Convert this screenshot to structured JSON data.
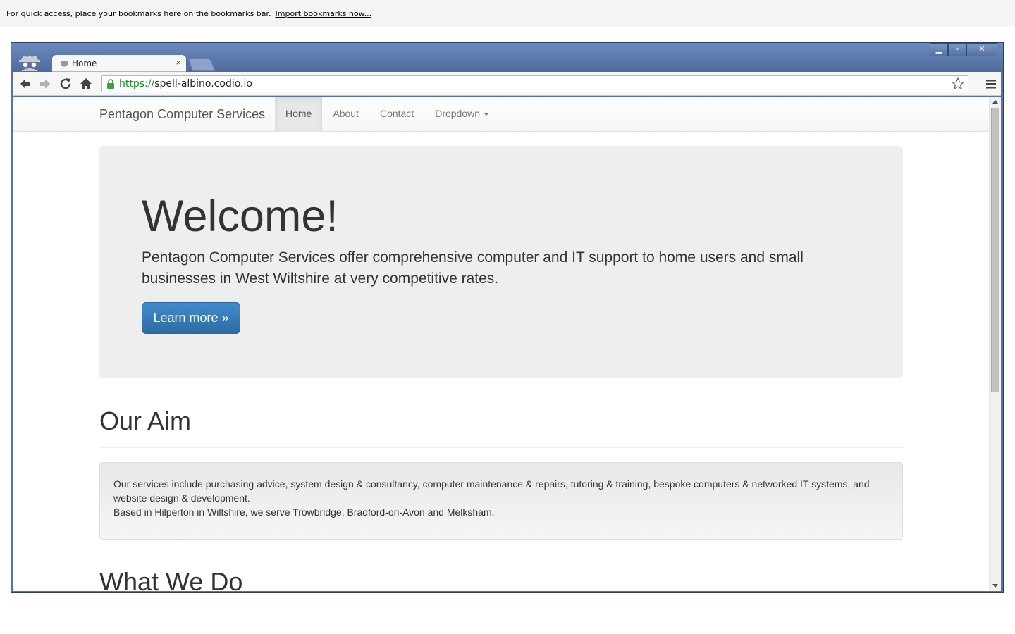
{
  "bookmarks_bar": {
    "message": "For quick access, place your bookmarks here on the bookmarks bar.",
    "import_link": "Import bookmarks now..."
  },
  "browser": {
    "tab_title": "Home",
    "tab_close": "×",
    "url_scheme": "https://",
    "url_host": "spell-albino.codio.io",
    "window_controls": [
      "minimize",
      "maximize",
      "close"
    ]
  },
  "site": {
    "brand": "Pentagon Computer Services",
    "nav": [
      {
        "label": "Home",
        "active": true
      },
      {
        "label": "About",
        "active": false
      },
      {
        "label": "Contact",
        "active": false
      },
      {
        "label": "Dropdown",
        "active": false
      }
    ],
    "hero": {
      "heading": "Welcome!",
      "lead": "Pentagon Computer Services offer comprehensive computer and IT support to home users and small businesses in West Wiltshire at very competitive rates.",
      "button": "Learn more »"
    },
    "aim": {
      "heading": "Our Aim",
      "line1": "Our services include purchasing advice, system design & consultancy, computer maintenance & repairs, tutoring & training, bespoke computers & networked IT systems, and website design & development.",
      "line2": "Based in Hilperton in Wiltshire, we serve Trowbridge, Bradford-on-Avon and Melksham."
    },
    "what_we_do": {
      "heading": "What We Do"
    }
  },
  "colors": {
    "primary_button": "#428bca",
    "window_frame": "#5773a6",
    "secure_scheme": "#138a29"
  }
}
